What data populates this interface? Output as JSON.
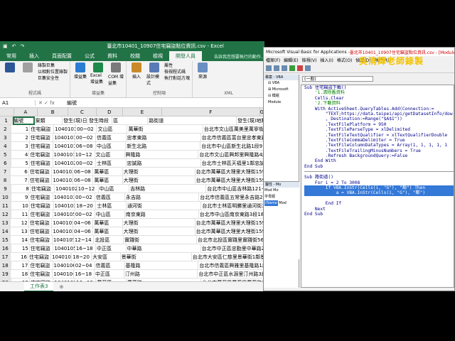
{
  "excel": {
    "title": "臺北市10401_10907住宅竊盜點位資訊.csv - Excel",
    "tabs": [
      "常用",
      "插入",
      "頁面配置",
      "公式",
      "資料",
      "校閱",
      "檢視",
      "開發人員"
    ],
    "active_tab": "開發人員",
    "tell_me": "告訴我您想要執行的動作...",
    "ribbon": {
      "code_items": [
        "錄製巨集",
        "以相對位置錄製",
        "巨集安全性"
      ],
      "code_label": "程式碼",
      "addins": [
        {
          "label": "增益集",
          "color": "#2b7cd3"
        },
        {
          "label": "Excel 增益集",
          "color": "#1e8a4a"
        },
        {
          "label": "COM 增益集",
          "color": "#7a7a7a"
        }
      ],
      "addins_label": "增益集",
      "controls": [
        {
          "label": "插入",
          "color": "#c98a2a"
        },
        {
          "label": "設計模式",
          "color": "#5a7ab5"
        }
      ],
      "controls_items": [
        "屬性",
        "檢視程式碼",
        "執行對話方塊"
      ],
      "controls_label": "控制項",
      "source_label": "來源",
      "xml_label": "XML"
    },
    "name_box": "A1",
    "formula_value": "編號",
    "columns": [
      "",
      "A",
      "B",
      "C",
      "D",
      "E",
      "F",
      "G"
    ],
    "headers": [
      "編號",
      "案類",
      "發生(現)日期",
      "發生時段",
      "區",
      "路街道",
      "發生(現)地點"
    ],
    "rows": [
      [
        "1",
        "住宅竊盜",
        "1040101",
        "00~02",
        "文山區",
        "萬華街",
        "台北市文山區萬美里萬寧街1~30號"
      ],
      [
        "2",
        "住宅竊盜",
        "1040101",
        "00~02",
        "信義區",
        "忠孝東路",
        "台北市信義區富台里忠孝東路5段295"
      ],
      [
        "3",
        "住宅竊盜",
        "1040101",
        "06~08",
        "中山區",
        "新生北路",
        "台北市中山區新生北路1段91~120號"
      ],
      [
        "4",
        "住宅竊盜",
        "1040101",
        "10~12",
        "文山區",
        "興隆路",
        "台北市文山區興邦里興隆路4段1~30號"
      ],
      [
        "5",
        "住宅竊盜",
        "1040102",
        "00~02",
        "士林區",
        "忠誠路",
        "台北市士林區天福里1鄰忠誠路2段53"
      ],
      [
        "6",
        "住宅竊盜",
        "1040102",
        "06~08",
        "萬華區",
        "大理街",
        "台北市萬華區大理里大理街159巷1~30號"
      ],
      [
        "7",
        "住宅竊盜",
        "1040102",
        "06~08",
        "萬華區",
        "大理街",
        "台北市萬華區大理里大理街159巷1~30號"
      ],
      [
        "8",
        "住宅竊盜",
        "1040102",
        "10~12",
        "中山區",
        "吉林路",
        "台北市中山區吉林路121~150號"
      ],
      [
        "9",
        "住宅竊盜",
        "1040103",
        "00~02",
        "信義區",
        "永吉路",
        "台北市信義區五常里永吉路225巷32弄"
      ],
      [
        "10",
        "住宅竊盜",
        "1040103",
        "18~20",
        "士林區",
        "通河街",
        "台北市士林區明勝里通河街31~60號"
      ],
      [
        "11",
        "住宅竊盜",
        "1040105",
        "00~02",
        "中山區",
        "南京東路",
        "台北市中山區南京東路3段181~210號"
      ],
      [
        "12",
        "住宅竊盜",
        "1040105",
        "04~06",
        "萬華區",
        "大理街",
        "台北市萬華區大理里大理街159巷1~30號"
      ],
      [
        "13",
        "住宅竊盜",
        "1040105",
        "04~06",
        "萬華區",
        "大理街",
        "台北市萬華區大理里大理街159巷1~30號"
      ],
      [
        "14",
        "住宅竊盜",
        "1040105",
        "12~14",
        "北投區",
        "實踐街",
        "台北市北投區實踐里實踐街56巷1~30號"
      ],
      [
        "15",
        "住宅竊盜",
        "1040105",
        "16~18",
        "中正區",
        "中華路",
        "台北市中正區忠勤里中華路2段311巷"
      ],
      [
        "16",
        "住宅竊盜",
        "1040105",
        "18~20",
        "大安區",
        "景華街",
        "台北市大安區仁慈里景華街1鄰景華街61~90"
      ],
      [
        "17",
        "住宅竊盜",
        "1040106",
        "02~04",
        "信義區",
        "基隆路",
        "台北市信義區興雅里基隆路1段1~30號"
      ],
      [
        "18",
        "住宅竊盜",
        "1040106",
        "16~18",
        "中正區",
        "汀州路",
        "台北市中正區水源里汀州路3段91~120"
      ],
      [
        "19",
        "住宅竊盜",
        "1040107",
        "16~18",
        "萬華區",
        "萬芳路",
        "台北市萬華區萬芳里萬芳路31~60號"
      ],
      [
        "20",
        "住宅竊盜",
        "1040107",
        "18~20",
        "北投區",
        "石牌路",
        "台北市北投區石牌路1段1~30號"
      ]
    ],
    "sheet_tab": "工作表3",
    "add_sheet": "⊕"
  },
  "vba": {
    "title_prefix": "Microsoft Visual Basic for Applications - ",
    "title_file": "臺北市10401_10907住宅竊盜點位資訊.csv - [Module1 (程式碼)]",
    "menu": [
      "檔案(F)",
      "編輯(E)",
      "檢視(V)",
      "插入(I)",
      "格式(O)",
      "偵錯(D)",
      "執行(R)"
    ],
    "banner": "吳清輝老師錄製",
    "project_title": "專案 - VBA",
    "project_tree": [
      "⊟ VBA",
      "⊞ Microsoft",
      "⊟ 模組",
      "Module"
    ],
    "props_title": "屬性 - Mo",
    "props_name": "Mod Mo",
    "props_tab": "字母順",
    "props_row": [
      "(Name",
      "Mod"
    ],
    "dd_left": "(一般)",
    "code": [
      {
        "t": "Sub 住宅竊盜下載()",
        "c": ""
      },
      {
        "t": "    '1.清除舊資料",
        "c": "cm"
      },
      {
        "t": "    Cells.Clear",
        "c": ""
      },
      {
        "t": "    '2.下載資料",
        "c": "cm"
      },
      {
        "t": "    With ActiveSheet.QueryTables.Add(Connection:= _",
        "c": ""
      },
      {
        "t": "        \"TEXT;https://data.taipei/api/getDatasetInfo/dow",
        "c": ""
      },
      {
        "t": "        , Destination:=Range(\"$A$1\"))",
        "c": ""
      },
      {
        "t": "        .TextFilePlatform = 950",
        "c": ""
      },
      {
        "t": "        .TextFileParseType = xlDelimited",
        "c": ""
      },
      {
        "t": "        .TextFileTextQualifier = xlTextQualifierDouble",
        "c": ""
      },
      {
        "t": "        .TextFileCommaDelimiter = True",
        "c": ""
      },
      {
        "t": "        .TextFileColumnDataTypes = Array(1, 1, 1, 1, 1",
        "c": ""
      },
      {
        "t": "        .TextFileTrailingMinusNumbers = True",
        "c": ""
      },
      {
        "t": "        .Refresh BackgroundQuery:=False",
        "c": ""
      },
      {
        "t": "    End With",
        "c": ""
      },
      {
        "t": "End Sub",
        "c": ""
      },
      {
        "t": "",
        "c": "sep"
      },
      {
        "t": "Sub 路街道()",
        "c": ""
      },
      {
        "t": "    For i = 2 To 3008",
        "c": ""
      },
      {
        "t": "        If VBA.InStr(Cells(i, \"G\"), \"鄰\") Then",
        "c": "sel"
      },
      {
        "t": "            a = VBA.InStr(Cells(i, \"G\"), \"鄰\")",
        "c": "sel"
      },
      {
        "t": "",
        "c": ""
      },
      {
        "t": "        End If",
        "c": ""
      },
      {
        "t": "    Next",
        "c": ""
      },
      {
        "t": "End Sub",
        "c": ""
      }
    ]
  }
}
